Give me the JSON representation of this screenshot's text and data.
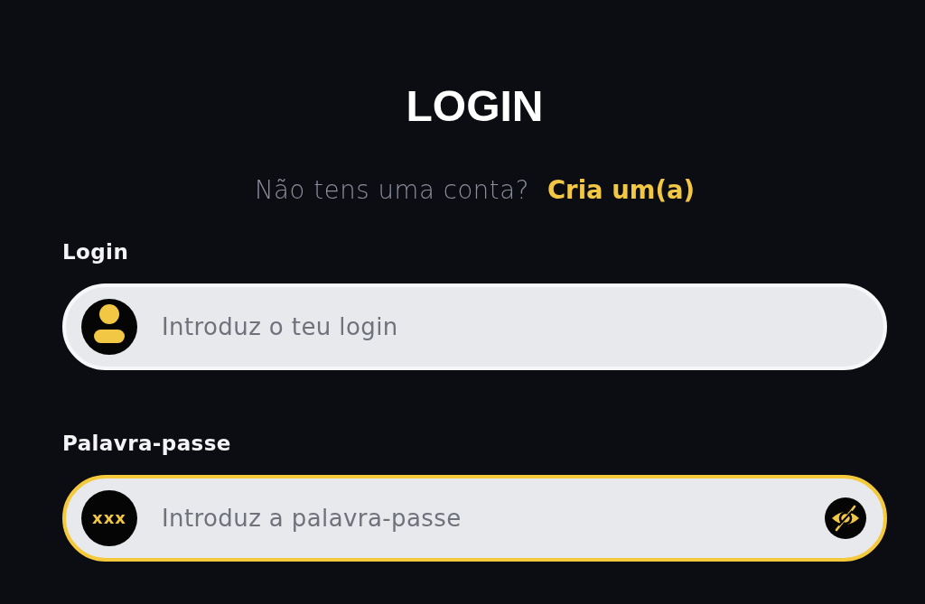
{
  "title": "LOGIN",
  "signup_prompt": {
    "text": "Não tens uma conta?",
    "link": "Cria um(a)"
  },
  "fields": [
    {
      "kind": "text",
      "label": "Login",
      "placeholder": "Introduz o teu login",
      "focused": false
    },
    {
      "kind": "password",
      "label": "Palavra-passe",
      "placeholder": "Introduz a palavra-passe",
      "focused": true,
      "badge": "xxx",
      "revealed": false
    }
  ]
}
